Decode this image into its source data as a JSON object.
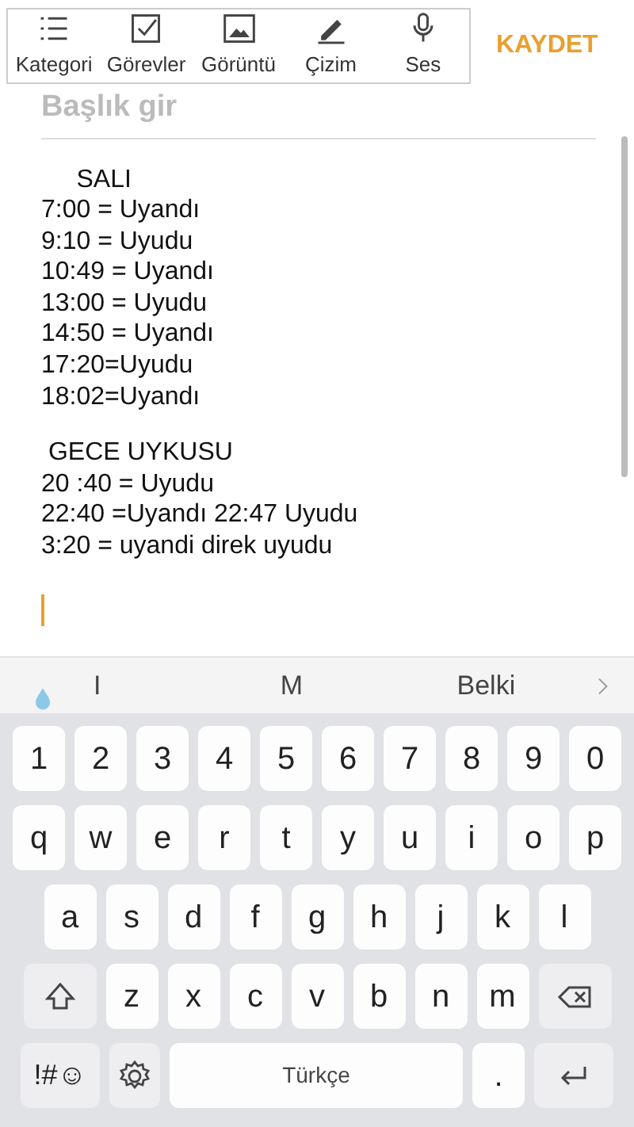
{
  "toolbar": {
    "tools": [
      {
        "kind": "category",
        "label": "Kategori"
      },
      {
        "kind": "tasks",
        "label": "Görevler"
      },
      {
        "kind": "image",
        "label": "Görüntü"
      },
      {
        "kind": "drawing",
        "label": "Çizim"
      },
      {
        "kind": "voice",
        "label": "Ses"
      }
    ],
    "save": "KAYDET"
  },
  "note": {
    "title_placeholder": "Başlık gir",
    "paragraphs": [
      [
        "     SALI",
        "7:00 = Uyandı",
        "9:10 = Uyudu",
        "10:49 = Uyandı",
        "13:00 = Uyudu",
        "14:50 = Uyandı",
        "17:20=Uyudu",
        "18:02=Uyandı"
      ],
      [
        " GECE UYKUSU",
        "20 :40 = Uyudu",
        "22:40 =Uyandı 22:47 Uyudu",
        "3:20 = uyandi direk uyudu"
      ]
    ]
  },
  "suggestions": [
    "I",
    "M",
    "Belki"
  ],
  "keyboard": {
    "rows": [
      [
        {
          "kind": "char",
          "label": "1"
        },
        {
          "kind": "char",
          "label": "2"
        },
        {
          "kind": "char",
          "label": "3"
        },
        {
          "kind": "char",
          "label": "4"
        },
        {
          "kind": "char",
          "label": "5"
        },
        {
          "kind": "char",
          "label": "6"
        },
        {
          "kind": "char",
          "label": "7"
        },
        {
          "kind": "char",
          "label": "8"
        },
        {
          "kind": "char",
          "label": "9"
        },
        {
          "kind": "char",
          "label": "0"
        }
      ],
      [
        {
          "kind": "char",
          "label": "q"
        },
        {
          "kind": "char",
          "label": "w"
        },
        {
          "kind": "char",
          "label": "e"
        },
        {
          "kind": "char",
          "label": "r"
        },
        {
          "kind": "char",
          "label": "t"
        },
        {
          "kind": "char",
          "label": "y"
        },
        {
          "kind": "char",
          "label": "u"
        },
        {
          "kind": "char",
          "label": "i"
        },
        {
          "kind": "char",
          "label": "o"
        },
        {
          "kind": "char",
          "label": "p"
        }
      ],
      [
        {
          "kind": "char",
          "label": "a"
        },
        {
          "kind": "char",
          "label": "s"
        },
        {
          "kind": "char",
          "label": "d"
        },
        {
          "kind": "char",
          "label": "f"
        },
        {
          "kind": "char",
          "label": "g"
        },
        {
          "kind": "char",
          "label": "h"
        },
        {
          "kind": "char",
          "label": "j"
        },
        {
          "kind": "char",
          "label": "k"
        },
        {
          "kind": "char",
          "label": "l"
        }
      ],
      [
        {
          "kind": "shift"
        },
        {
          "kind": "char",
          "label": "z"
        },
        {
          "kind": "char",
          "label": "x"
        },
        {
          "kind": "char",
          "label": "c"
        },
        {
          "kind": "char",
          "label": "v"
        },
        {
          "kind": "char",
          "label": "b"
        },
        {
          "kind": "char",
          "label": "n"
        },
        {
          "kind": "char",
          "label": "m"
        },
        {
          "kind": "backspace"
        }
      ]
    ],
    "bottom_row": {
      "symbols": "!#☺",
      "space": "Türkçe",
      "period": "."
    }
  }
}
